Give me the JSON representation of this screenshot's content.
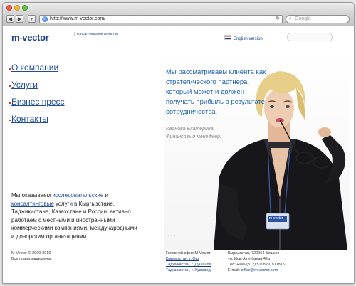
{
  "browser": {
    "url": "http://www.m-vector.com/",
    "search_placeholder": "Google"
  },
  "logo": {
    "brand_m": "m",
    "brand_dash": "-",
    "brand_rest": "vector",
    "tagline": "консалтинговое агенство"
  },
  "header": {
    "lang_link": "English version"
  },
  "menu": {
    "items": [
      "О компании",
      "Услуги",
      "Бизнес пресс",
      "Контакты"
    ]
  },
  "intro": {
    "text_1": "Мы оказываем ",
    "link_1": "исследовательские",
    "text_2": " и ",
    "link_2": "консалтинговые",
    "text_3": " услуги в Кыргызстане, Таджикистане, Казахстане и России, активно работаем с местными и иностранными коммерческими компаниями, международными и донорским организациями."
  },
  "hero": {
    "quote": "Мы рассматриваем клиента как стратегического партнера, который может и должен получать прибыль в результате сотрудничества.",
    "signer_name": "Иванова Екатерина.",
    "signer_title": "Финансовый менеджер.",
    "badge_text": "m-vector"
  },
  "footer": {
    "copyright_1": "M-Vector © 2000-2010",
    "copyright_2": "Все права защищены.",
    "office_title": "Головной офис M-Vector:",
    "offices": [
      "Кыргызстан, г. Ош",
      "Таджикистан, г. Душанбе",
      "Таджикистан, г. Худжанд"
    ],
    "address_1": "Кыргызстан, 720064 Бишкек",
    "address_2": "ул. Исы Ахунбаева 42а",
    "phone": "Тел: +996 (312) 510829, 511815",
    "email_label": "E-mail: ",
    "email": "office@m-vector.com"
  },
  "colors": {
    "brand_blue": "#1f3f86",
    "accent_red": "#d33b2c",
    "quote_blue": "#1f62ad"
  }
}
